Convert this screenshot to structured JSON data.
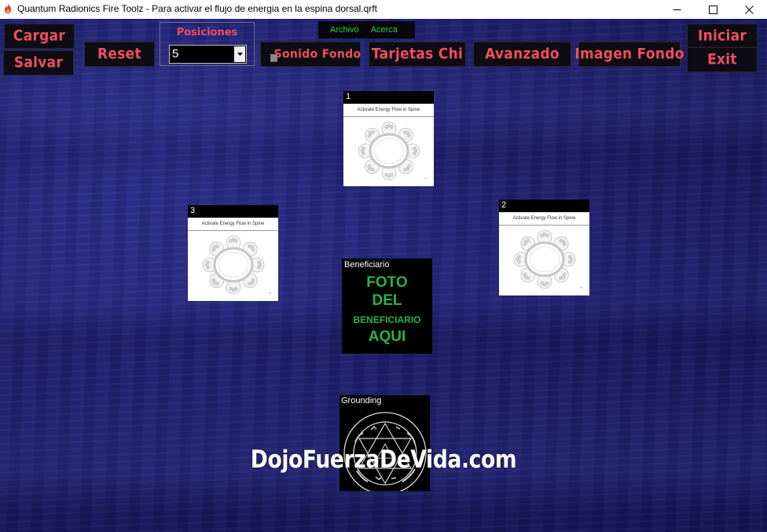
{
  "window": {
    "title": "Quantum Radionics Fire Toolz - Para activar el flujo de energia en la espina dorsal.qrft",
    "app_icon": "fire-icon",
    "controls": [
      "minimize-icon",
      "maximize-icon",
      "close-icon"
    ]
  },
  "menu": {
    "archivo": "Archivo",
    "acerca": "Acerca"
  },
  "toolbar": {
    "cargar": "Cargar",
    "salvar": "Salvar",
    "reset": "Reset",
    "posiciones_label": "Posiciones",
    "posiciones_value": "5",
    "sonido_fondo": "Sonido Fondo",
    "tarjetas_chi": "Tarjetas Chi",
    "avanzado": "Avanzado",
    "imagen_fondo": "Imagen Fondo",
    "iniciar": "Iniciar",
    "exit": "Exit"
  },
  "cards": [
    {
      "number": "1",
      "subtitle": "Activate Energy Flow in Spine"
    },
    {
      "number": "2",
      "subtitle": "Activate Energy Flow in Spine"
    },
    {
      "number": "3",
      "subtitle": "Activate Energy Flow in Spine"
    }
  ],
  "beneficiary": {
    "header": "Beneficiario",
    "lines": [
      "FOTO",
      "DEL",
      "BENEFICIARIO",
      "AQUI"
    ]
  },
  "grounding": {
    "header": "Grounding"
  },
  "watermark": "DojoFuerzaDeVida.com",
  "colors": {
    "button_text": "#ef4f5c",
    "button_bg": "#0c0c12",
    "menu_text": "#2fd12f",
    "beneficiary_text": "#26b34a",
    "background": "#1d1f6e"
  }
}
